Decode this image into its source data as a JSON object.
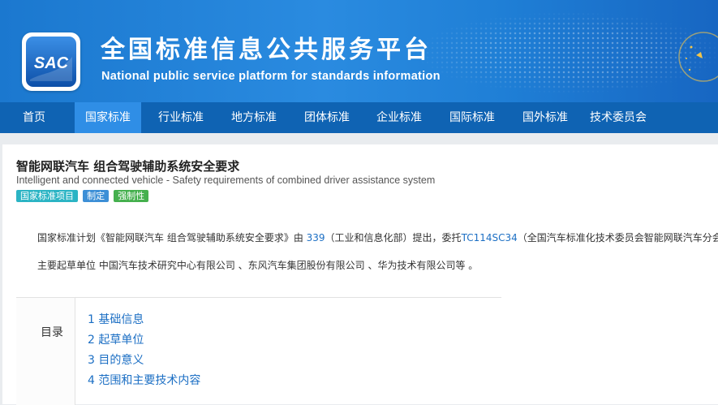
{
  "header": {
    "logo_text": "SAC",
    "title_zh": "全国标准信息公共服务平台",
    "title_en": "National public service platform  for standards information"
  },
  "nav": {
    "items": [
      {
        "label": "首页"
      },
      {
        "label": "国家标准"
      },
      {
        "label": "行业标准"
      },
      {
        "label": "地方标准"
      },
      {
        "label": "团体标准"
      },
      {
        "label": "企业标准"
      },
      {
        "label": "国际标准"
      },
      {
        "label": "国外标准"
      },
      {
        "label": "技术委员会"
      }
    ],
    "active": "国家标准"
  },
  "standard": {
    "title_zh": "智能网联汽车 组合驾驶辅助系统安全要求",
    "title_en": "Intelligent and connected vehicle - Safety requirements of combined driver assistance system",
    "tags": [
      "国家标准项目",
      "制定",
      "强制性"
    ],
    "plan": {
      "prefix": "国家标准计划《智能网联汽车 组合驾驶辅助系统安全要求》由 ",
      "tc_number": "339",
      "middle": "（工业和信息化部）提出，委托",
      "committee_code": "TC114SC34",
      "suffix": "（全国汽车标准化技术委员会智能网联汽车分会"
    },
    "drafters": "主要起草单位 中国汽车技术研究中心有限公司 、东风汽车集团股份有限公司 、华为技术有限公司等 。"
  },
  "toc": {
    "label": "目录",
    "items": [
      "1  基础信息",
      "2  起草单位",
      "3  目的意义",
      "4  范围和主要技术内容"
    ]
  },
  "colors": {
    "banner": "#2a8be0",
    "nav": "#0f63b3",
    "nav_active": "#2f8ee6",
    "link": "#1c6fc4"
  }
}
